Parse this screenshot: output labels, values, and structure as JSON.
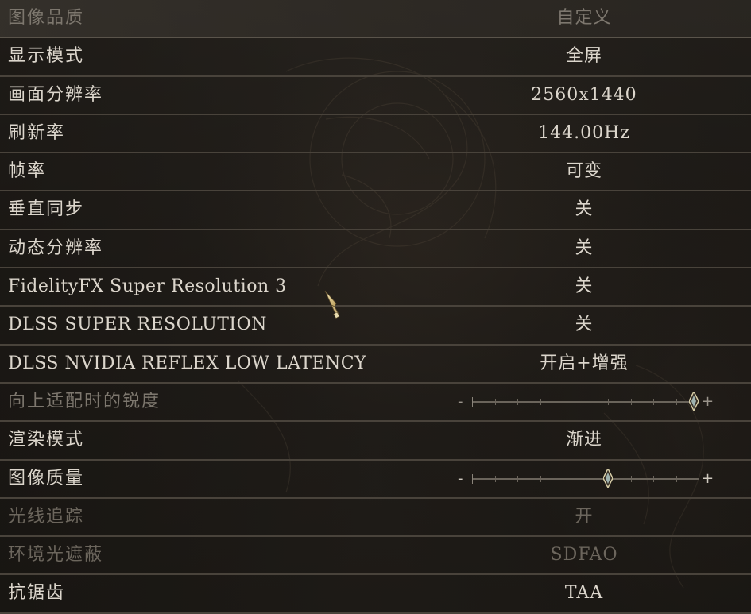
{
  "settings": {
    "rows": [
      {
        "label": "图像品质",
        "value": "自定义"
      },
      {
        "label": "显示模式",
        "value": "全屏"
      },
      {
        "label": "画面分辨率",
        "value": "2560x1440"
      },
      {
        "label": "刷新率",
        "value": "144.00Hz"
      },
      {
        "label": "帧率",
        "value": "可变"
      },
      {
        "label": "垂直同步",
        "value": "关"
      },
      {
        "label": "动态分辨率",
        "value": "关"
      },
      {
        "label": "FidelityFX Super Resolution 3",
        "value": "关"
      },
      {
        "label": "DLSS SUPER RESOLUTION",
        "value": "关"
      },
      {
        "label": "DLSS NVIDIA REFLEX LOW LATENCY",
        "value": "开启+增强"
      },
      {
        "label": "向上适配时的锐度",
        "slider_level": 0.98,
        "minus": "-",
        "plus": "+"
      },
      {
        "label": "渲染模式",
        "value": "渐进"
      },
      {
        "label": "图像质量",
        "slider_level": 0.6,
        "minus": "-",
        "plus": "+"
      },
      {
        "label": "光线追踪",
        "value": "开"
      },
      {
        "label": "环境光遮蔽",
        "value": "SDFAO"
      },
      {
        "label": "抗锯齿",
        "value": "TAA"
      }
    ]
  },
  "colors": {
    "text": "#dcd6cc",
    "text_dim": "#7d776e",
    "divider": "#49433b",
    "slider_handle": "#d9cfa8"
  },
  "icons": {
    "cursor": "sword-cursor-icon",
    "slider_handle": "diamond-handle-icon"
  }
}
